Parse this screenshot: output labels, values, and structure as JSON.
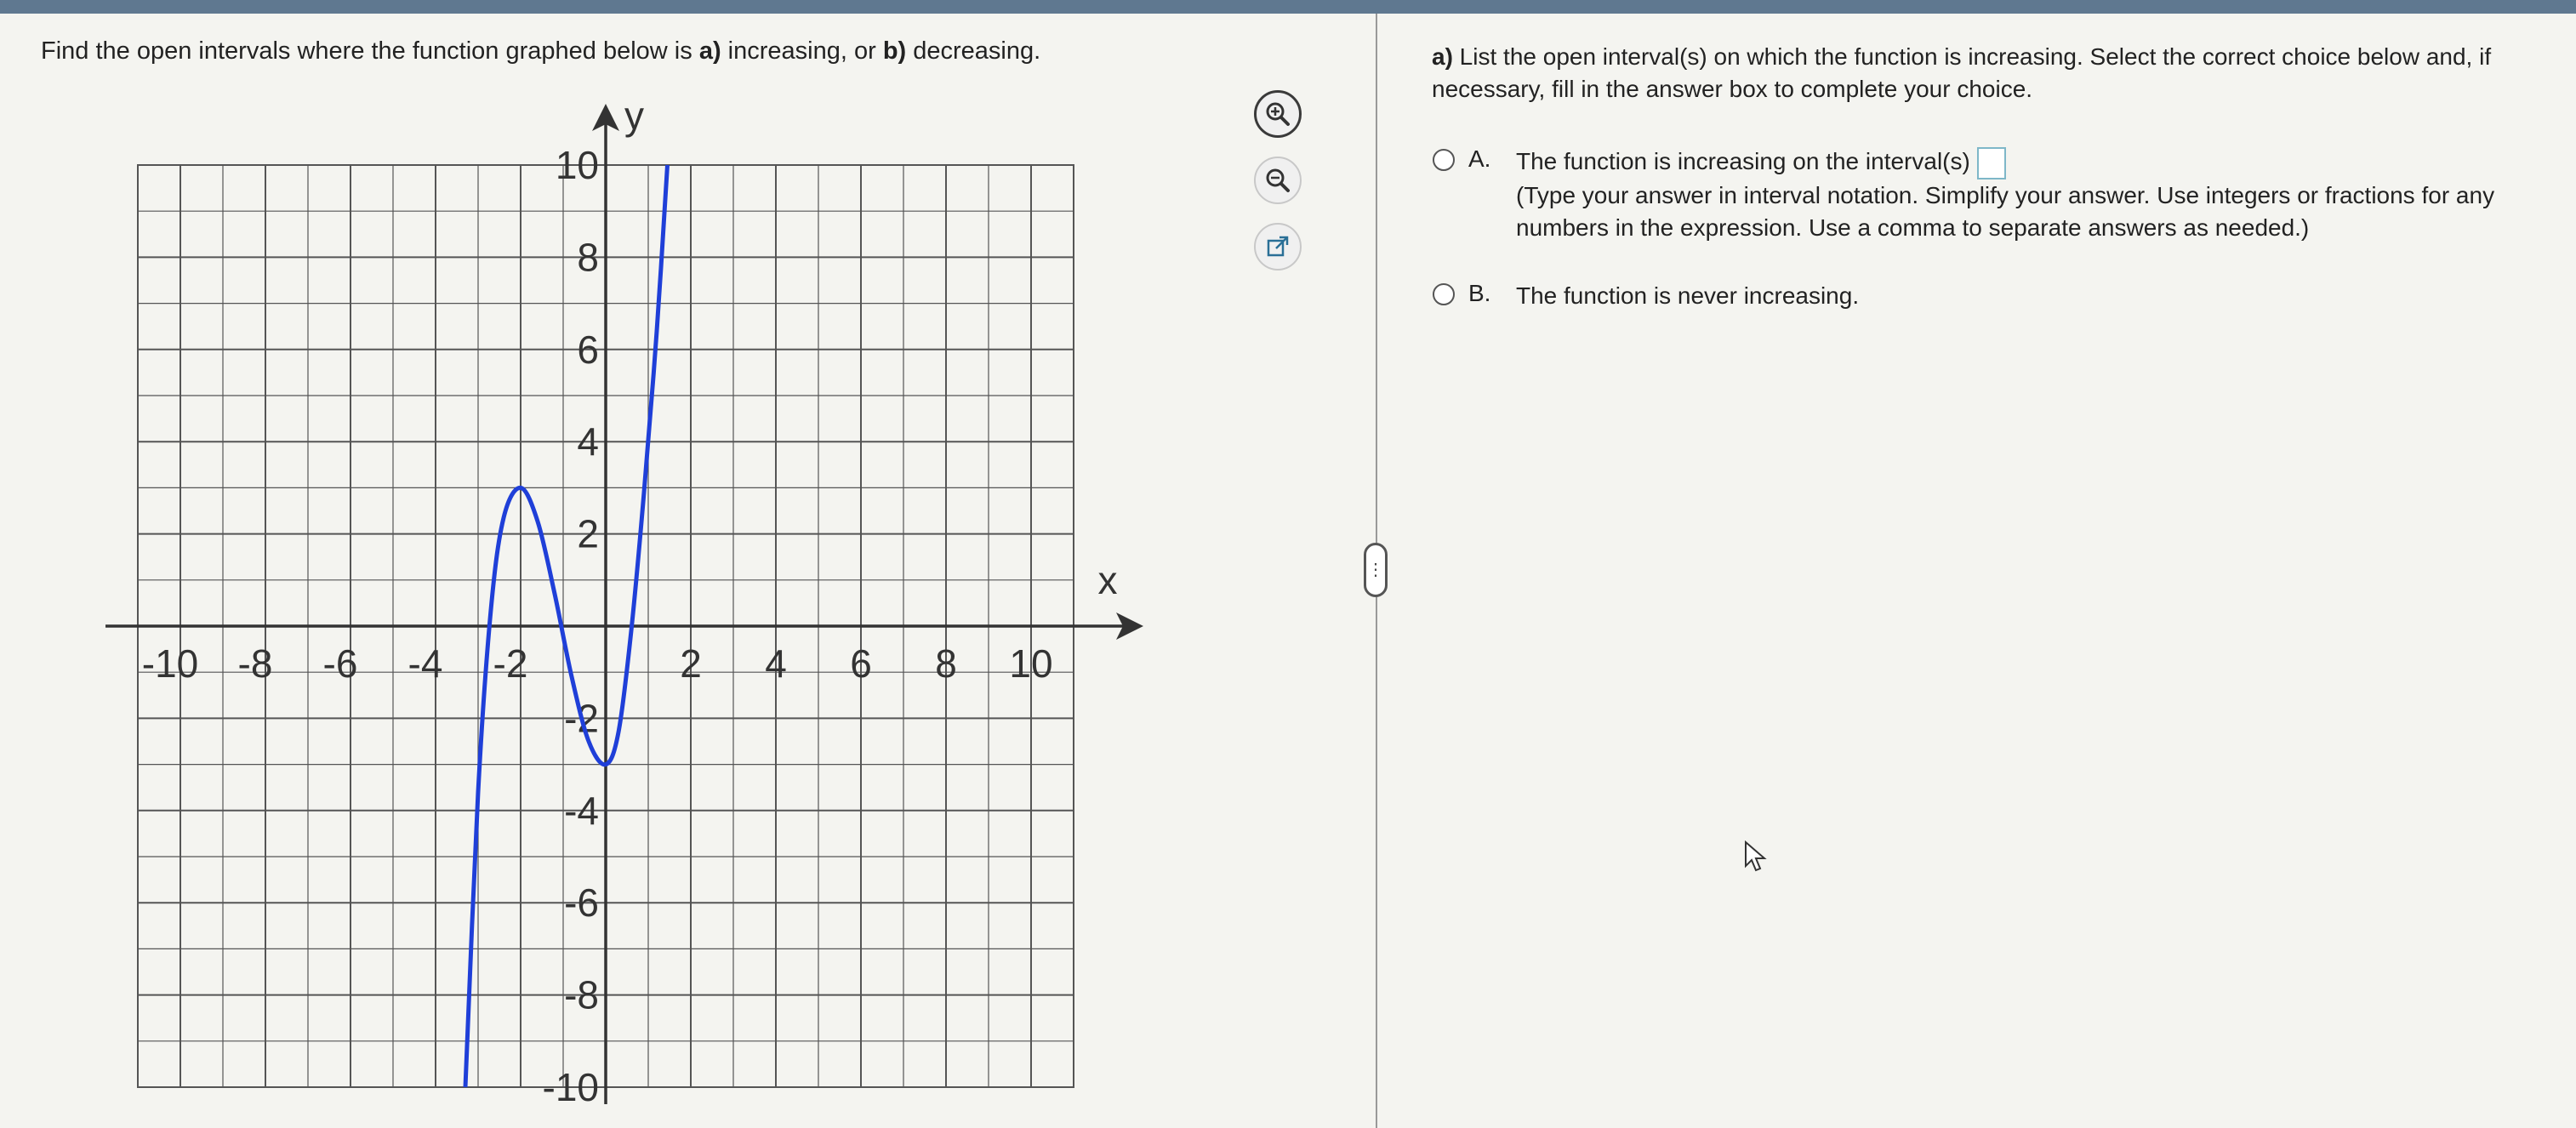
{
  "left": {
    "question_prefix": "Find the open intervals where the function graphed below is ",
    "question_a": "a)",
    "question_mid": " increasing, or ",
    "question_b": "b)",
    "question_suffix": " decreasing."
  },
  "graph": {
    "x_axis_label": "x",
    "y_axis_label": "y",
    "x_ticks": [
      "-10",
      "-8",
      "-6",
      "-4",
      "-2",
      "2",
      "4",
      "6",
      "8",
      "10"
    ],
    "y_ticks": [
      "10",
      "8",
      "6",
      "4",
      "2",
      "-2",
      "-4",
      "-6",
      "-8",
      "-10"
    ],
    "curve_color": "#1f3fd8",
    "curve_points": [
      [
        -3.3,
        -10
      ],
      [
        -3.0,
        -3.6
      ],
      [
        -2.7,
        0.35
      ],
      [
        -2.4,
        2.35
      ],
      [
        -2.0,
        3.0
      ],
      [
        -1.6,
        2.27
      ],
      [
        -1.2,
        0.7
      ],
      [
        -0.8,
        -1.1
      ],
      [
        -0.4,
        -2.5
      ],
      [
        0.0,
        -3.0
      ],
      [
        0.3,
        -2.3
      ],
      [
        0.6,
        -0.1
      ],
      [
        0.9,
        2.9
      ],
      [
        1.2,
        6.4
      ],
      [
        1.45,
        10
      ]
    ]
  },
  "tools": {
    "zoom_in": "zoom-in-icon",
    "zoom_out": "zoom-out-icon",
    "popout": "external-link-icon"
  },
  "right": {
    "part_label": "a)",
    "instruction": " List the open interval(s) on which the function is increasing. Select the correct choice below and, if necessary, fill in the answer box to complete your choice.",
    "choice_a_letter": "A.",
    "choice_a_text": "The function is increasing on the interval(s)",
    "choice_a_hint": "(Type your answer in interval notation. Simplify your answer. Use integers or fractions for any numbers in the expression. Use a comma to separate answers as needed.)",
    "choice_b_letter": "B.",
    "choice_b_text": "The function is never increasing."
  }
}
